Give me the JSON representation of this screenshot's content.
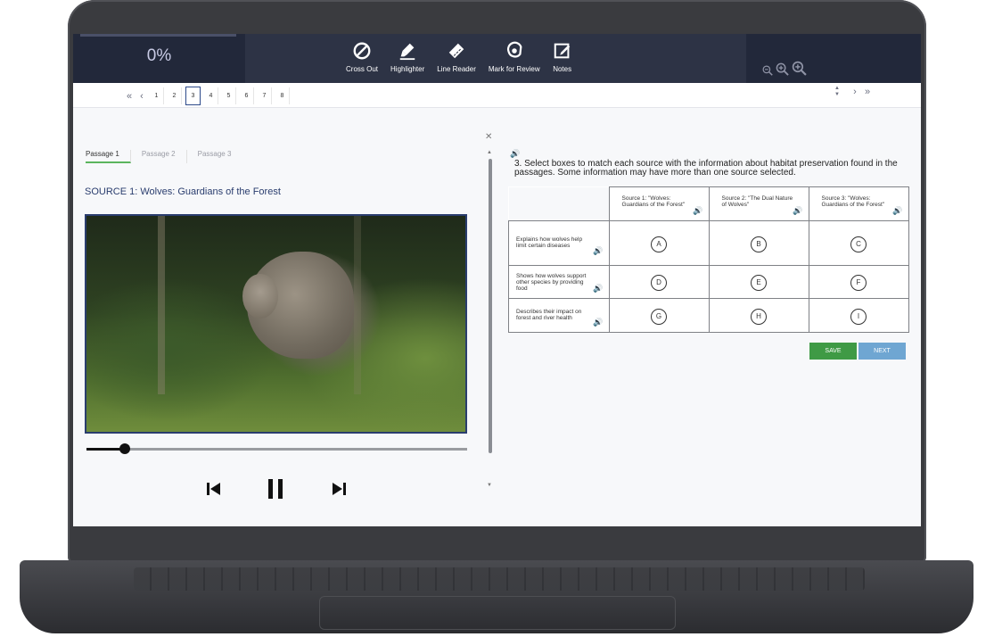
{
  "toolbar": {
    "progress_percent_label": "0%",
    "progress_fraction": 0.0,
    "tools": [
      {
        "label": "Cross Out",
        "icon": "cross-out-icon"
      },
      {
        "label": "Highlighter",
        "icon": "highlighter-icon"
      },
      {
        "label": "Line Reader",
        "icon": "line-reader-icon"
      },
      {
        "label": "Mark for Review",
        "icon": "mark-for-review-icon"
      },
      {
        "label": "Notes",
        "icon": "notes-icon"
      }
    ],
    "zoom_icons": [
      "zoom-out-icon",
      "zoom-reset-icon",
      "zoom-in-icon"
    ]
  },
  "pagination": {
    "pages": [
      "1",
      "2",
      "3",
      "4",
      "5",
      "6",
      "7",
      "8"
    ],
    "current_page": "3",
    "first_glyph": "«",
    "prev_glyph": "‹",
    "next_glyph": "›",
    "last_glyph": "»",
    "up_glyph": "▲",
    "down_glyph": "▼"
  },
  "passage": {
    "tabs": [
      "Passage 1",
      "Passage 2",
      "Passage 3"
    ],
    "active_tab": "Passage 1",
    "source_title": "SOURCE 1: Wolves: Guardians of the Forest",
    "video_progress_fraction": 0.1
  },
  "question": {
    "text": "3. Select boxes to match each source with the information about habitat preservation found in the passages. Some information may have more than one source selected.",
    "columns": [
      "Source 1: \"Wolves: Guardians of the Forest\"",
      "Source 2: \"The Dual Nature of Wolves\"",
      "Source 3: \"Wolves: Guardians of the Forest\""
    ],
    "rows": [
      {
        "label": "Explains how wolves help limit certain diseases",
        "options": [
          "A",
          "B",
          "C"
        ]
      },
      {
        "label": "Shows how wolves support other species by providing food",
        "options": [
          "D",
          "E",
          "F"
        ]
      },
      {
        "label": "Describes their impact on forest and river health",
        "options": [
          "G",
          "H",
          "I"
        ]
      }
    ],
    "save_label": "SAVE",
    "next_label": "NEXT"
  },
  "colors": {
    "toolbar_bg": "#2d3345",
    "accent_purple": "#8a84d8",
    "save_green": "#3f9a45",
    "next_blue": "#6fa6d2",
    "title_blue": "#2a3d6e"
  }
}
